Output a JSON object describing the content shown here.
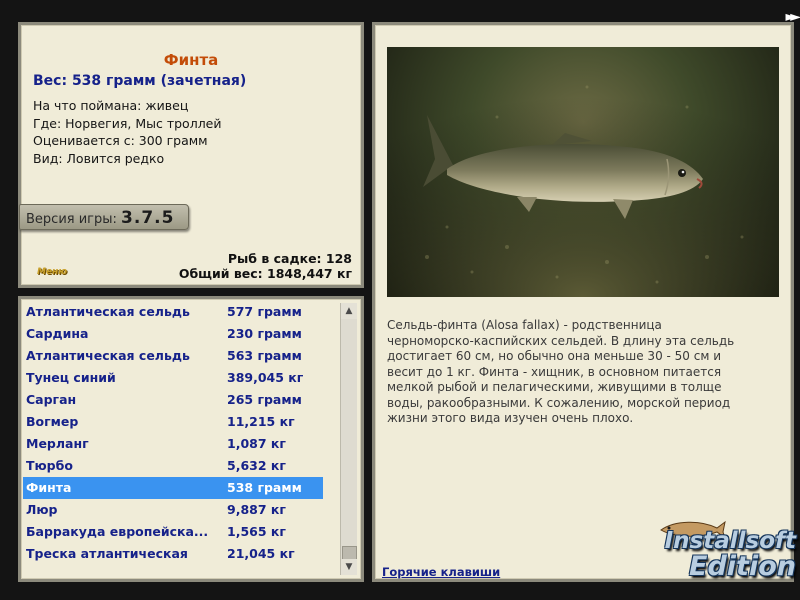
{
  "nav": {
    "next_icon": "►►"
  },
  "info": {
    "title": "Финта",
    "weight_line": "Вес: 538 грамм (зачетная)",
    "lines": [
      "На что поймана: живец",
      "Где: Норвегия, Мыс троллей",
      "Оценивается с: 300 грамм",
      "Вид: Ловится редко"
    ],
    "version_label": "Версия игры:",
    "version_value": "3.7.5",
    "menu_label": "Меню",
    "fish_in_cage": "Рыб в садке: 128",
    "total_weight": "Общий вес: 1848,447 кг"
  },
  "catch_list": {
    "rows": [
      {
        "name": "Атлантическая сельдь",
        "weight": "577 грамм"
      },
      {
        "name": "Сардина",
        "weight": "230 грамм"
      },
      {
        "name": "Атлантическая сельдь",
        "weight": "563 грамм"
      },
      {
        "name": "Тунец синий",
        "weight": "389,045 кг"
      },
      {
        "name": "Сарган",
        "weight": "265 грамм"
      },
      {
        "name": "Вогмер",
        "weight": "11,215 кг"
      },
      {
        "name": "Мерланг",
        "weight": "1,087 кг"
      },
      {
        "name": "Тюрбо",
        "weight": "5,632 кг"
      },
      {
        "name": "Финта",
        "weight": "538 грамм"
      },
      {
        "name": "Люр",
        "weight": "9,887 кг"
      },
      {
        "name": "Барракуда европейска...",
        "weight": "1,565 кг"
      },
      {
        "name": "Треска атлантическая",
        "weight": "21,045 кг"
      }
    ],
    "selected_index": 8
  },
  "description": {
    "text": "Сельдь-финта (Alosa fallax) - родственница черноморско-каспийских сельдей. В длину эта сельдь достигает 60 см, но обычно она меньше 30 - 50 см и весит до 1 кг. Финта - хищник, в основном питается мелкой рыбой и пелагическими, живущими в толще воды, ракообразными. К сожалению, морской период жизни этого вида изучен очень плохо.",
    "hotkeys_link": "Горячие клавиши"
  },
  "watermark": {
    "line1": "Installsoft",
    "line2": "Edition"
  }
}
